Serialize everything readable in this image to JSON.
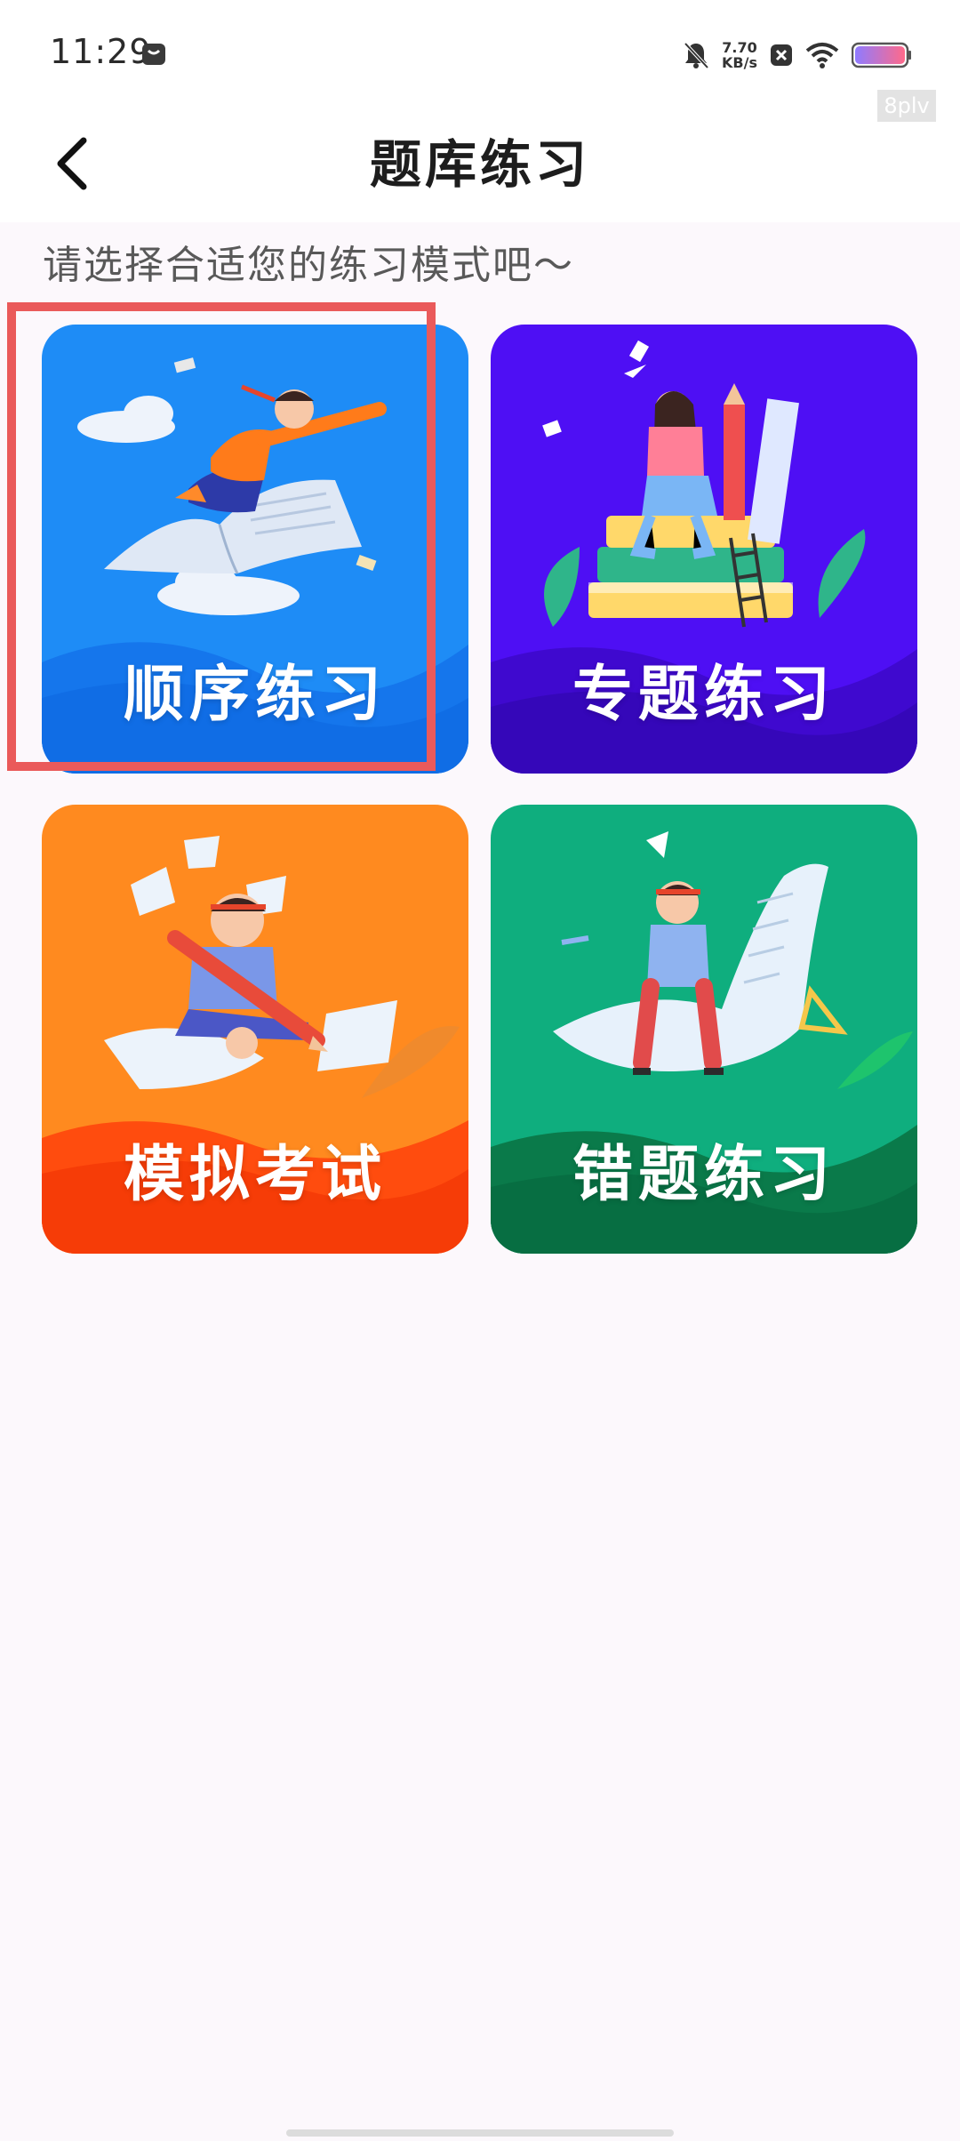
{
  "status_bar": {
    "time": "11:29",
    "net_speed_value": "7.70",
    "net_speed_unit": "KB/s",
    "watermark": "8plv"
  },
  "header": {
    "title": "题库练习"
  },
  "subtitle": "请选择合适您的练习模式吧～",
  "cards": [
    {
      "label": "顺序练习",
      "color": "#1e8cf6"
    },
    {
      "label": "专题练习",
      "color": "#4e0ff4"
    },
    {
      "label": "模拟考试",
      "color": "#ff8a1f"
    },
    {
      "label": "错题练习",
      "color": "#0fae7e"
    }
  ],
  "colors": {
    "highlight": "#ea5a5a",
    "background": "#fcf8fc"
  }
}
